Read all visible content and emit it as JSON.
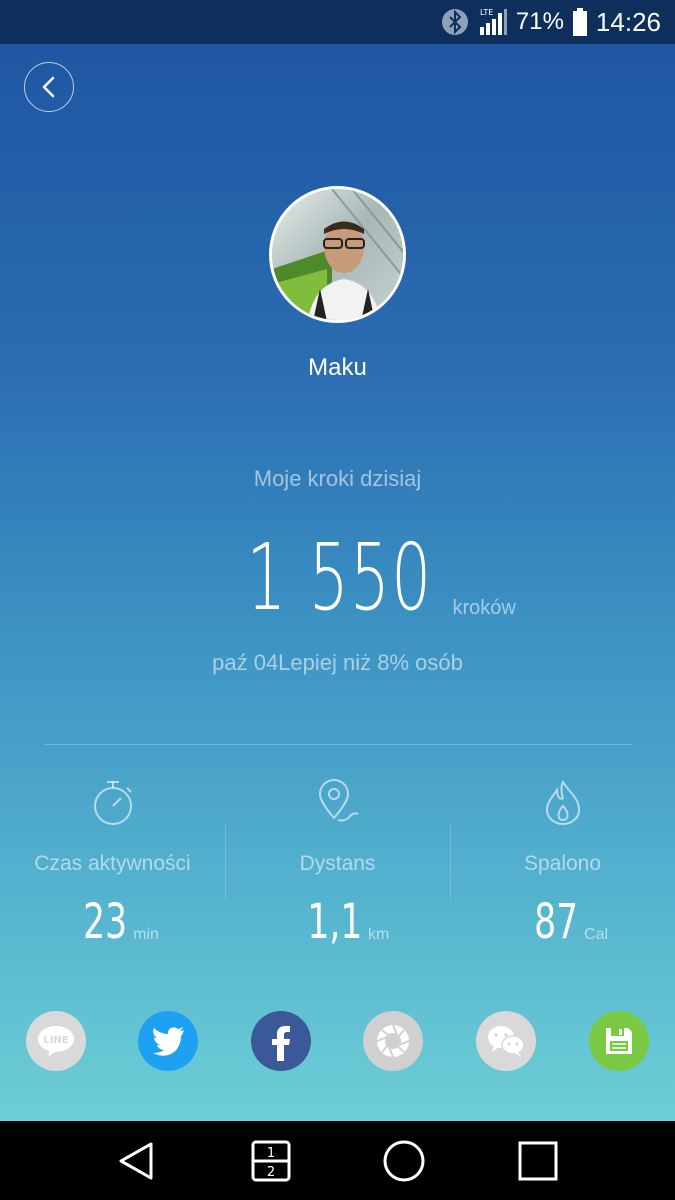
{
  "status_bar": {
    "network": "LTE",
    "battery": "71%",
    "time": "14:26"
  },
  "profile": {
    "name": "Maku"
  },
  "steps": {
    "caption": "Moje kroki dzisiaj",
    "value": "1 550",
    "unit": "kroków",
    "comparison": "paź 04Lepiej niż 8% osób"
  },
  "stats": [
    {
      "icon": "stopwatch-icon",
      "label": "Czas aktywności",
      "value": "23",
      "unit": "min"
    },
    {
      "icon": "location-pin-icon",
      "label": "Dystans",
      "value": "1,1",
      "unit": "km"
    },
    {
      "icon": "flame-icon",
      "label": "Spalono",
      "value": "87",
      "unit": "Cal"
    }
  ],
  "share": {
    "line_label": "LINE",
    "buttons": [
      "line",
      "twitter",
      "facebook",
      "camera-aperture",
      "wechat",
      "save"
    ],
    "colors": {
      "line": "#d9d9d9",
      "twitter": "#1da1f2",
      "facebook": "#3b5998",
      "aperture": "#d0d0d0",
      "wechat": "#d9d9d9",
      "save": "#7ac943"
    }
  },
  "nav": {
    "recents_top": "1",
    "recents_bottom": "2"
  }
}
